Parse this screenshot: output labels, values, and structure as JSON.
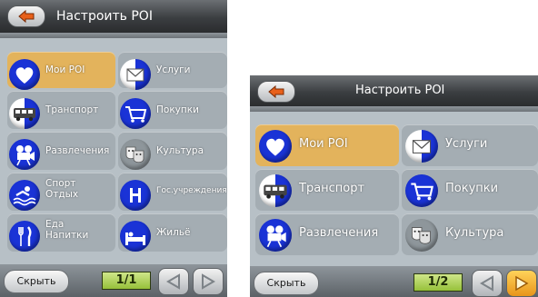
{
  "screens": [
    {
      "title": "Настроить POI",
      "items": [
        {
          "label": "Мои POI",
          "icon": "heart-icon"
        },
        {
          "label": "Услуги",
          "icon": "mail-icon"
        },
        {
          "label": "Транспорт",
          "icon": "bus-icon"
        },
        {
          "label": "Покупки",
          "icon": "shopping-cart-icon"
        },
        {
          "label": "Развлечения",
          "icon": "film-camera-icon"
        },
        {
          "label": "Культура",
          "icon": "theater-masks-icon"
        },
        {
          "label": "Спорт\nОтдых",
          "icon": "swimmer-icon"
        },
        {
          "label": "Гос.учреждения",
          "icon": "hospital-h-icon"
        },
        {
          "label": "Еда\nНапитки",
          "icon": "fork-knife-icon"
        },
        {
          "label": "Жильё",
          "icon": "bed-icon"
        }
      ],
      "hide_label": "Скрыть",
      "page": "1/1"
    },
    {
      "title": "Настроить POI",
      "items": [
        {
          "label": "Мои POI",
          "icon": "heart-icon"
        },
        {
          "label": "Услуги",
          "icon": "mail-icon"
        },
        {
          "label": "Транспорт",
          "icon": "bus-icon"
        },
        {
          "label": "Покупки",
          "icon": "shopping-cart-icon"
        },
        {
          "label": "Развлечения",
          "icon": "film-camera-icon"
        },
        {
          "label": "Культура",
          "icon": "theater-masks-icon"
        }
      ],
      "hide_label": "Скрыть",
      "page": "1/2"
    }
  ],
  "colors": {
    "selected_tile": "#e3b35c",
    "tile": "#a4adb3",
    "icon_circle": "#1a33d6",
    "page_indicator": "#96c13a"
  }
}
